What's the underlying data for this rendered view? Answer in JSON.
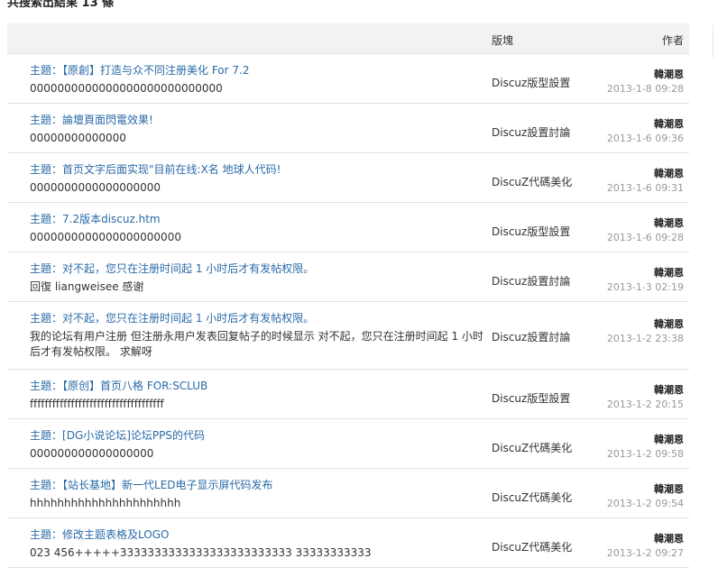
{
  "page": {
    "heading": "共搜索出結果 13 條",
    "columns": {
      "forum": "版塊",
      "author": "作者"
    },
    "subject_prefix": "主題："
  },
  "results": [
    {
      "title": "【原創】打造与众不同注册美化 For 7.2",
      "snippet": "0000000000000000000000000000",
      "forum": "Discuz版型設置",
      "author": "韓潮恩",
      "time": "2013-1-8 09:28"
    },
    {
      "title": "論壇頁面閃電效果!",
      "snippet": "00000000000000",
      "forum": "Discuz設置討論",
      "author": "韓潮恩",
      "time": "2013-1-6 09:36"
    },
    {
      "title": "首页文字后面实现\"目前在线:X名 地球人代码!",
      "snippet": "0000000000000000000",
      "forum": "DiscuZ代碼美化",
      "author": "韓潮恩",
      "time": "2013-1-6 09:31"
    },
    {
      "title": "7.2版本discuz.htm",
      "snippet": "0000000000000000000000",
      "forum": "Discuz版型設置",
      "author": "韓潮恩",
      "time": "2013-1-6 09:28"
    },
    {
      "title": "对不起，您只在注册时间起 1 小时后才有发帖权限。",
      "snippet": "回復 liangweisee 感谢",
      "forum": "Discuz設置討論",
      "author": "韓潮恩",
      "time": "2013-1-3 02:19"
    },
    {
      "title": "对不起，您只在注册时间起 1 小时后才有发帖权限。",
      "snippet": "我的论坛有用户注册 但注册永用户发表回复帖子的时候显示 对不起，您只在注册时间起 1 小时后才有发帖权限。 求解呀",
      "forum": "Discuz設置討論",
      "author": "韓潮恩",
      "time": "2013-1-2 23:38"
    },
    {
      "title": "【原创】首页八格 FOR:SCLUB",
      "snippet": "ffffffffffffffffffffffffffffffffffff",
      "forum": "Discuz版型設置",
      "author": "韓潮恩",
      "time": "2013-1-2 20:15"
    },
    {
      "title": "[DG小说论坛]论坛PPS的代码",
      "snippet": "000000000000000000",
      "forum": "DiscuZ代碼美化",
      "author": "韓潮恩",
      "time": "2013-1-2 09:58"
    },
    {
      "title": "【站长基地】新一代LED电子显示屏代码发布",
      "snippet": "hhhhhhhhhhhhhhhhhhhhhh",
      "forum": "DiscuZ代碼美化",
      "author": "韓潮恩",
      "time": "2013-1-2 09:54"
    },
    {
      "title": "修改主题表格及LOGO",
      "snippet": "023 456+++++3333333333333333333333333 33333333333",
      "forum": "DiscuZ代碼美化",
      "author": "韓潮恩",
      "time": "2013-1-2 09:27"
    }
  ]
}
